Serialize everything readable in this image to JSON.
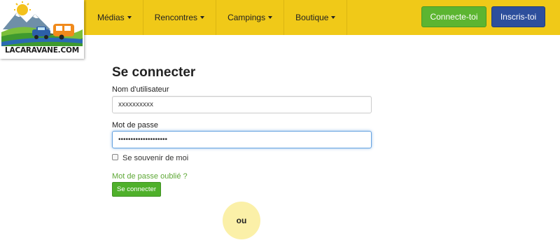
{
  "logo": {
    "text": "LACARAVANE.COM"
  },
  "nav": {
    "items": [
      {
        "label": "Médias"
      },
      {
        "label": "Rencontres"
      },
      {
        "label": "Campings"
      },
      {
        "label": "Boutique"
      }
    ],
    "login_label": "Connecte-toi",
    "signup_label": "Inscris-toi"
  },
  "form": {
    "title": "Se connecter",
    "username_label": "Nom d'utilisateur",
    "username_value": "xxxxxxxxxx",
    "password_label": "Mot de passe",
    "password_value": "••••••••••••••••••••",
    "remember_label": "Se souvenir de moi",
    "remember_checked": false,
    "forgot_label": "Mot de passe oublié ?",
    "submit_label": "Se connecter"
  },
  "divider": {
    "or_label": "ou"
  },
  "colors": {
    "navbar": "#f0c918",
    "login_button": "#5cb531",
    "signup_button": "#2d4f9c",
    "link": "#5ea836",
    "or_circle": "#fbf0a8"
  },
  "icons": [
    "caret-down-icon",
    "caravan-logo-icon"
  ]
}
